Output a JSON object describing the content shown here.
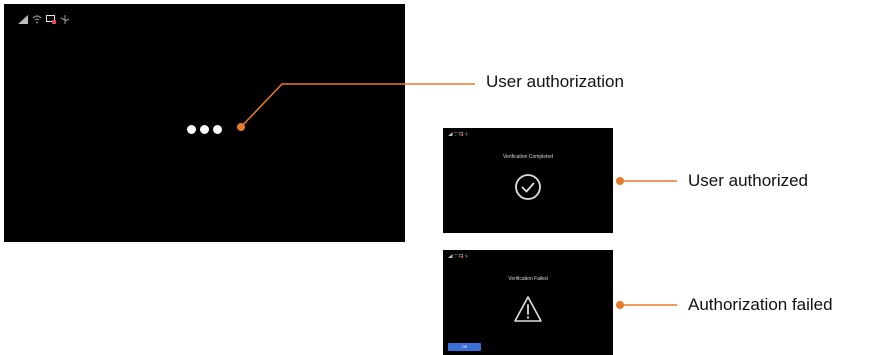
{
  "main_screen": {
    "status_icons": [
      "signal-icon",
      "wifi-icon",
      "phone-projection-icon",
      "usb-icon"
    ],
    "loading_indicator": "three-dots"
  },
  "success_screen": {
    "title": "Verification Completed",
    "icon": "check-circle-icon"
  },
  "failure_screen": {
    "title": "Verification Failed",
    "icon": "warning-triangle-icon",
    "button_label": "OK"
  },
  "callouts": {
    "user_authorization": "User authorization",
    "user_authorized": "User authorized",
    "authorization_failed": "Authorization failed"
  },
  "colors": {
    "screen_background": "#000000",
    "connector": "#e87a2e",
    "button": "#3c6fd6"
  }
}
